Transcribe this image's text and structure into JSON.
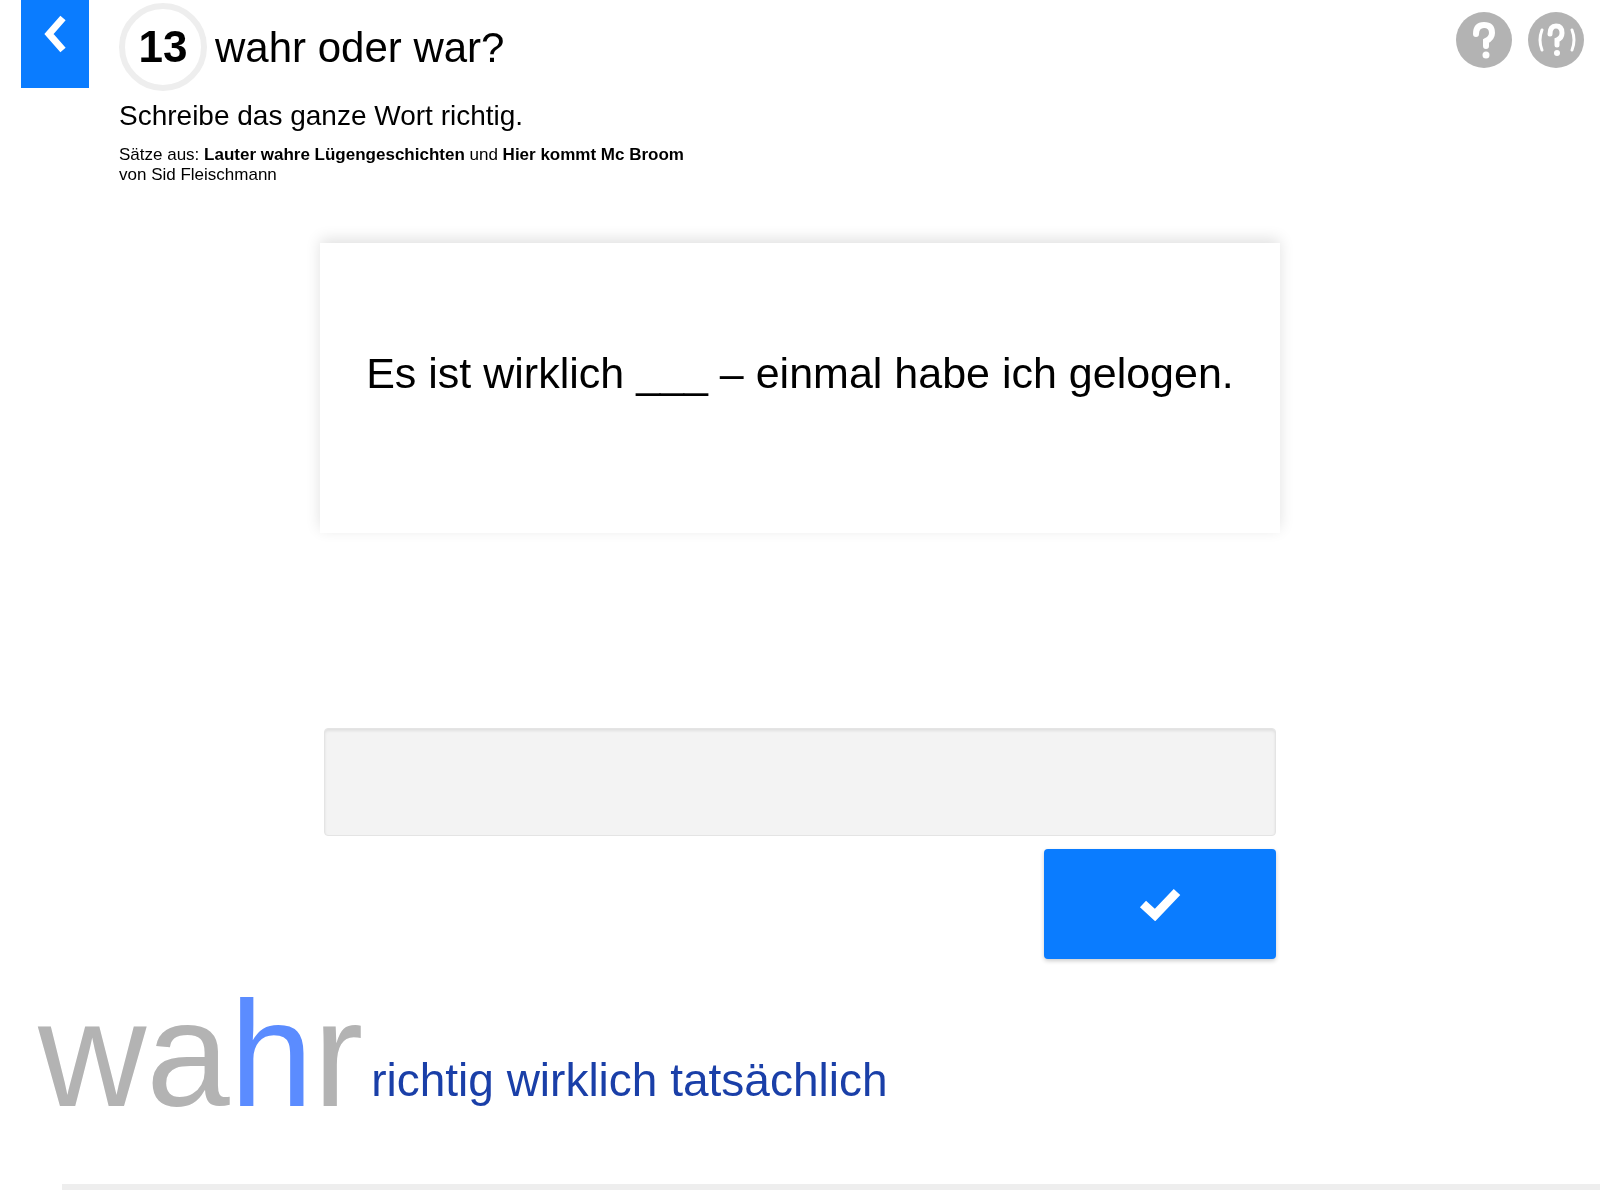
{
  "header": {
    "number": "13",
    "title": "wahr oder war?",
    "instruction": "Schreibe das ganze Wort richtig.",
    "source": "Sätze aus: **Lauter wahre Lügengeschichten** und **Hier kommt Mc Broom**",
    "author": "von Sid Fleischmann"
  },
  "card": {
    "sentence": "Es ist wirklich ___ – einmal habe ich gelogen."
  },
  "footer": {
    "logo": [
      {
        "text": "w",
        "color": "#b3b3b3"
      },
      {
        "text": "a",
        "color": "#b3b3b3"
      },
      {
        "text": "h",
        "color": "#5b8cff"
      },
      {
        "text": "r",
        "color": "#b3b3b3"
      }
    ],
    "meaning": "richtig wirklich tatsächlich"
  }
}
